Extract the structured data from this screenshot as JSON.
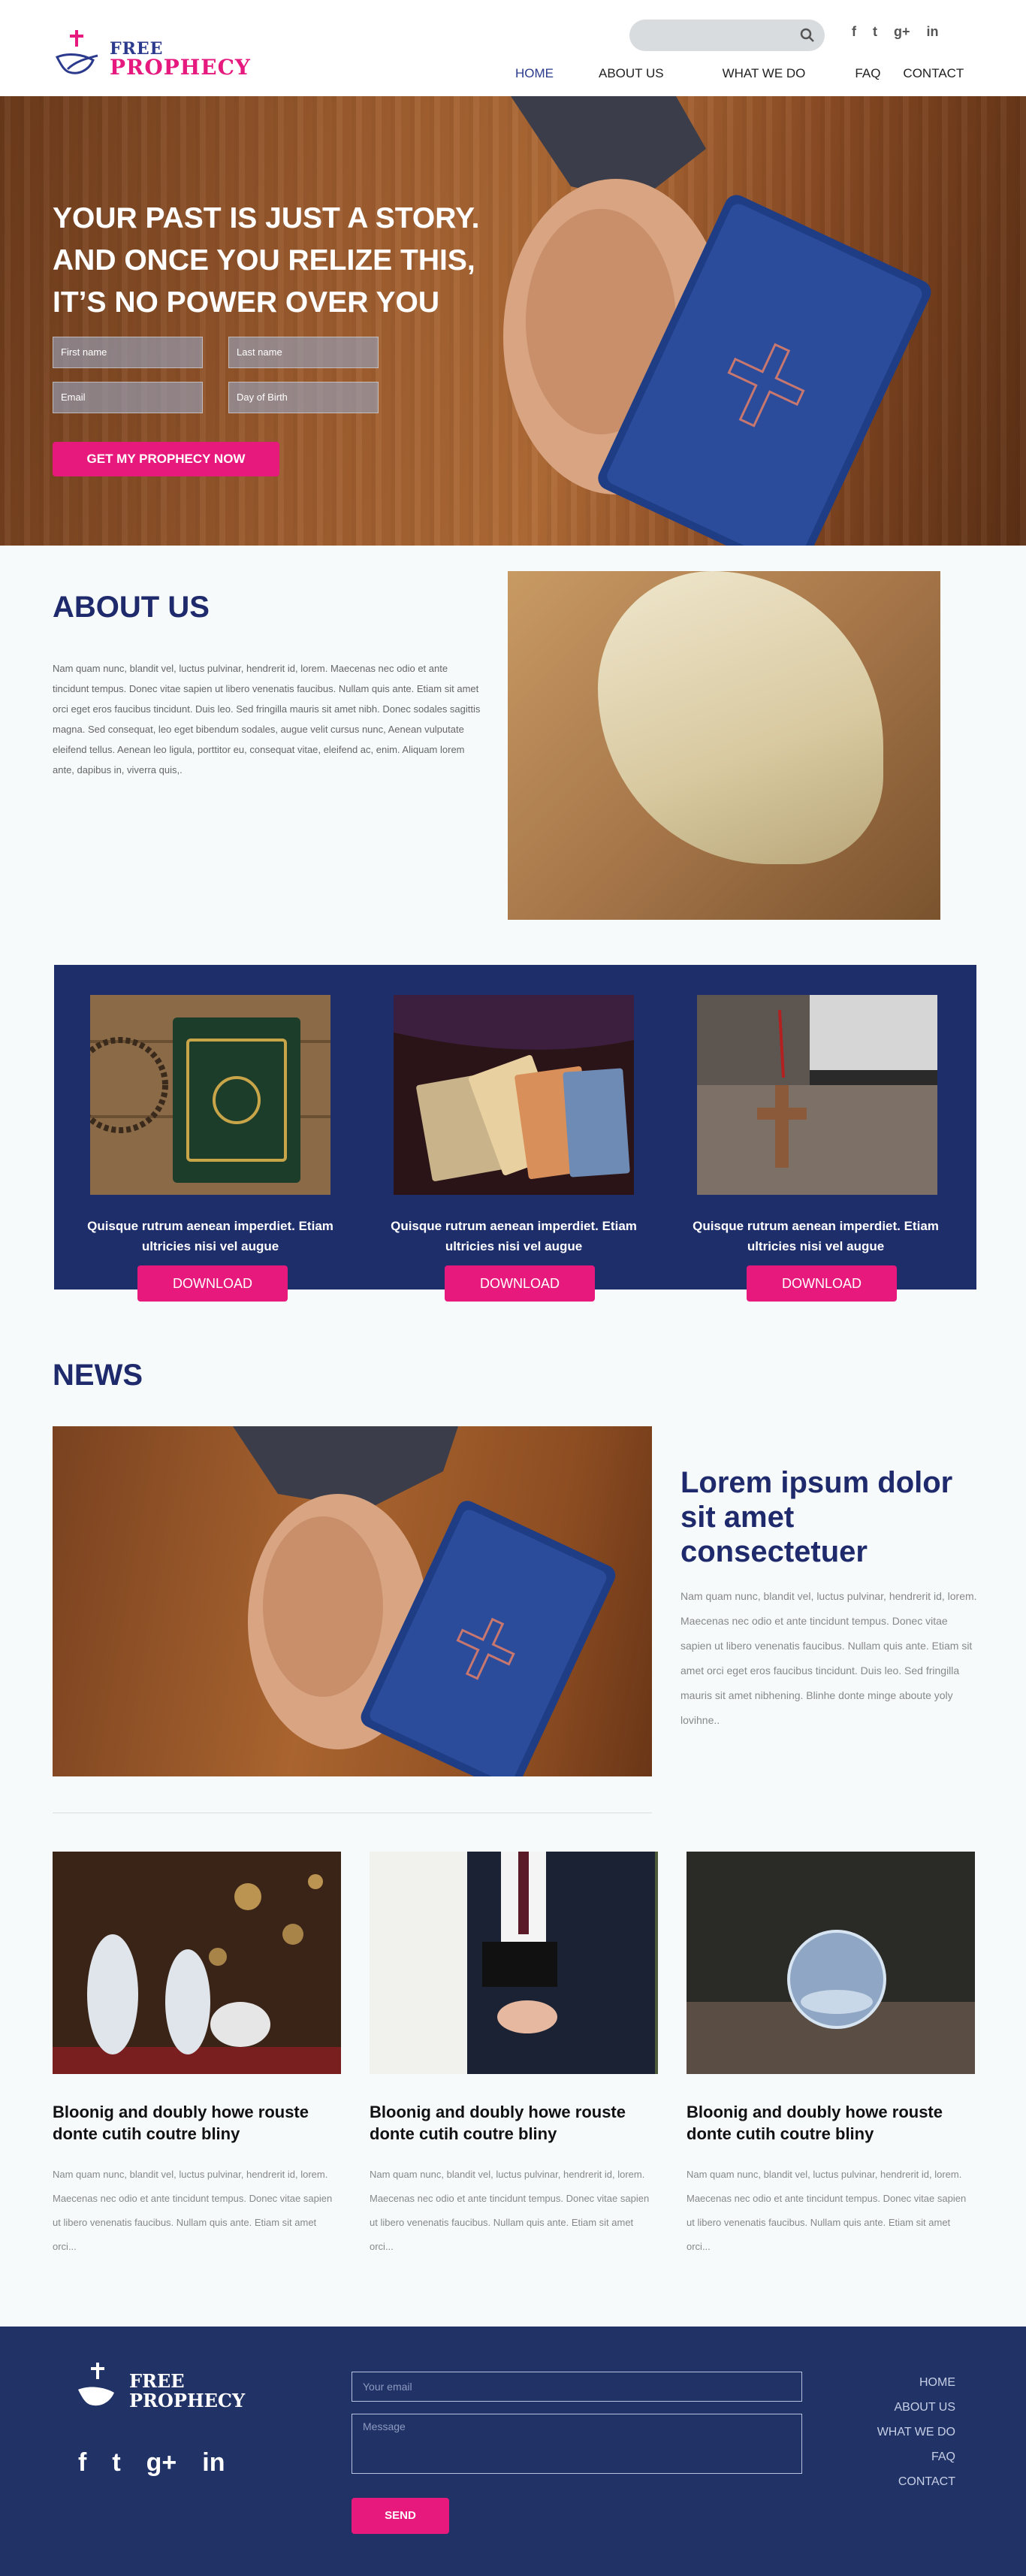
{
  "brand": {
    "line1": "FREE",
    "line2": "PROPHECY"
  },
  "search": {
    "placeholder": ""
  },
  "social": [
    "f",
    "t",
    "g+",
    "in"
  ],
  "nav": [
    "HOME",
    "ABOUT US",
    "WHAT WE DO",
    "FAQ",
    "CONTACT"
  ],
  "hero": {
    "headline": "YOUR PAST IS JUST A STORY. AND ONCE YOU RELIZE THIS, IT’S NO POWER OVER YOU",
    "first_name": "First name",
    "last_name": "Last name",
    "email": "Email",
    "dob": "Day of Birth",
    "cta": "GET MY PROPHECY NOW"
  },
  "about": {
    "title": "ABOUT US",
    "body": "Nam quam nunc, blandit vel, luctus pulvinar, hendrerit id, lorem. Maecenas nec odio et ante tincidunt tempus. Donec vitae sapien ut libero venenatis faucibus. Nullam quis ante. Etiam sit amet orci eget eros faucibus tincidunt. Duis leo. Sed fringilla mauris sit amet nibh. Donec sodales sagittis magna. Sed consequat, leo eget bibendum sodales, augue velit cursus nunc, Aenean vulputate eleifend tellus. Aenean leo ligula, porttitor eu, consequat vitae, eleifend ac, enim. Aliquam lorem ante, dapibus in, viverra quis,."
  },
  "cards": [
    {
      "title": "Quisque rutrum aenean imperdiet. Etiam ultricies nisi vel augue",
      "button": "DOWNLOAD"
    },
    {
      "title": "Quisque rutrum aenean imperdiet. Etiam ultricies nisi vel augue",
      "button": "DOWNLOAD"
    },
    {
      "title": "Quisque rutrum aenean imperdiet. Etiam ultricies nisi vel augue",
      "button": "DOWNLOAD"
    }
  ],
  "news": {
    "title": "NEWS",
    "headline": "Lorem ipsum dolor sit amet consectetuer",
    "body": "Nam quam nunc, blandit vel, luctus pulvinar, hendrerit id, lorem. Maecenas nec odio et ante tincidunt tempus. Donec vitae sapien ut libero venenatis faucibus. Nullam quis ante. Etiam sit amet orci eget eros faucibus tincidunt. Duis leo. Sed fringilla mauris sit amet nibhening. Blinhe donte minge aboute yoly lovihne.."
  },
  "posts": [
    {
      "title": "Bloonig and doubly howe rouste donte cutih coutre bliny",
      "body": "Nam quam nunc, blandit vel, luctus pulvinar, hendrerit id, lorem. Maecenas nec odio et ante tincidunt tempus. Donec vitae sapien ut libero venenatis faucibus. Nullam quis ante. Etiam sit amet orci..."
    },
    {
      "title": "Bloonig and doubly howe rouste donte cutih coutre bliny",
      "body": "Nam quam nunc, blandit vel, luctus pulvinar, hendrerit id, lorem. Maecenas nec odio et ante tincidunt tempus. Donec vitae sapien ut libero venenatis faucibus. Nullam quis ante. Etiam sit amet orci..."
    },
    {
      "title": "Bloonig and doubly howe rouste donte cutih coutre bliny",
      "body": "Nam quam nunc, blandit vel, luctus pulvinar, hendrerit id, lorem. Maecenas nec odio et ante tincidunt tempus. Donec vitae sapien ut libero venenatis faucibus. Nullam quis ante. Etiam sit amet orci..."
    }
  ],
  "footer": {
    "email_placeholder": "Your email",
    "message_placeholder": "Message",
    "send": "SEND",
    "nav": [
      "HOME",
      "ABOUT US",
      "WHAT WE DO",
      "FAQ",
      "CONTACT"
    ]
  },
  "colors": {
    "navy": "#1e2a6b",
    "pink": "#e8197d",
    "footer": "#203266"
  }
}
